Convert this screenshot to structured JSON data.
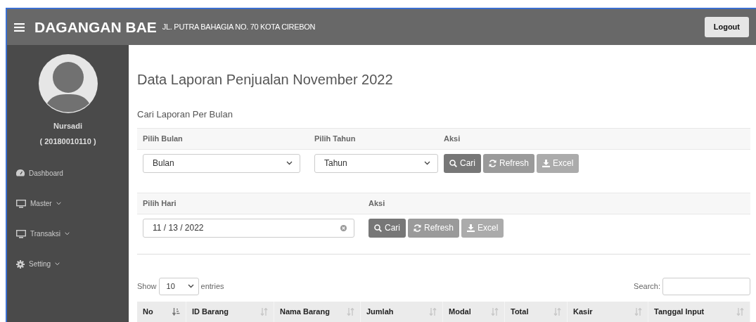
{
  "header": {
    "brand": "DAGANGAN BAE",
    "address": "JL. PUTRA BAHAGIA NO. 70 KOTA CIREBON",
    "logout": "Logout"
  },
  "sidebar": {
    "user_name": "Nursadi",
    "user_id": "( 20180010110 )",
    "items": [
      {
        "label": "Dashboard",
        "kind": "gauge",
        "expandable": false
      },
      {
        "label": "Master",
        "kind": "monitor",
        "expandable": true
      },
      {
        "label": "Transaksi",
        "kind": "monitor",
        "expandable": true
      },
      {
        "label": "Setting",
        "kind": "gear",
        "expandable": true
      }
    ]
  },
  "page_title": "Data Laporan Penjualan November 2022",
  "monthly_search": {
    "heading": "Cari Laporan Per Bulan",
    "month_label": "Pilih Bulan",
    "year_label": "Pilih Tahun",
    "action_label": "Aksi",
    "month_value": "Bulan",
    "year_value": "Tahun",
    "buttons": [
      {
        "label": "Cari",
        "kind": "search"
      },
      {
        "label": "Refresh",
        "kind": "refresh"
      },
      {
        "label": "Excel",
        "kind": "excel"
      }
    ]
  },
  "daily_search": {
    "day_label": "Pilih Hari",
    "action_label": "Aksi",
    "date_value": "11 / 13 / 2022",
    "buttons": [
      {
        "label": "Cari",
        "kind": "search"
      },
      {
        "label": "Refresh",
        "kind": "refresh"
      },
      {
        "label": "Excel",
        "kind": "excel"
      }
    ]
  },
  "table": {
    "show_label": "Show",
    "entries_value": "10",
    "entries_label": "entries",
    "search_label": "Search:",
    "columns": [
      {
        "label": "No",
        "sorted": true
      },
      {
        "label": "ID Barang",
        "sorted": false
      },
      {
        "label": "Nama Barang",
        "sorted": false
      },
      {
        "label": "Jumlah",
        "sorted": false
      },
      {
        "label": "Modal",
        "sorted": false
      },
      {
        "label": "Total",
        "sorted": false
      },
      {
        "label": "Kasir",
        "sorted": false
      },
      {
        "label": "Tanggal Input",
        "sorted": false
      }
    ]
  }
}
